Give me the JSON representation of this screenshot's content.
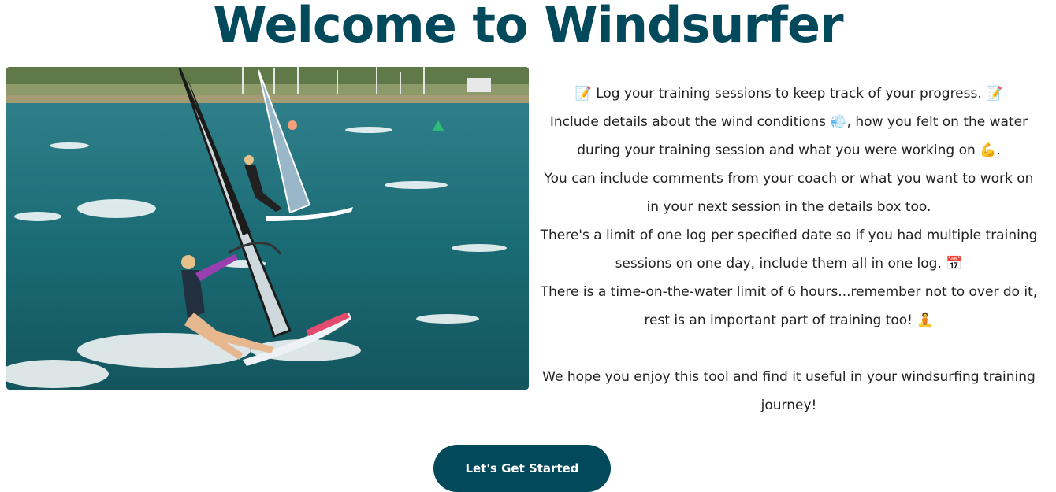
{
  "page": {
    "title": "Welcome to Windsurfer"
  },
  "hero_image": {
    "alt": "Two windsurfers sailing on choppy green water"
  },
  "intro": {
    "line1": "📝 Log your training sessions to keep track of your progress. 📝",
    "line2": "Include details about the wind conditions 💨, how you felt on the water during your training session and what you were working on 💪.",
    "line3": "You can include comments from your coach or what you want to work on in your next session in the details box too.",
    "line4": "There's a limit of one log per specified date so if you had multiple training sessions on one day, include them all in one log. 📅",
    "line5": "There is a time-on-the-water limit of 6 hours...remember not to over do it, rest is an important part of training too! 🧘",
    "closing": "We hope you enjoy this tool and find it useful in your windsurfing training journey!"
  },
  "cta": {
    "label": "Let's Get Started"
  },
  "colors": {
    "brand": "#03495c",
    "text": "#222222",
    "background": "#ffffff"
  }
}
